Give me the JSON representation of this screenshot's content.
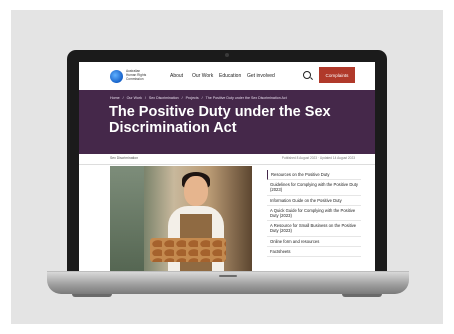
{
  "header": {
    "logo_text": "Australian Human Rights Commission",
    "nav": [
      "About",
      "Our Work",
      "Education",
      "Get involved"
    ],
    "complaints_label": "Complaints"
  },
  "breadcrumb": [
    "Home",
    "/",
    "Our Work",
    "/",
    "Sex Discrimination",
    "/",
    "Projects",
    "/",
    "The Positive Duty under the Sex Discrimination Act"
  ],
  "page_title": "The Positive Duty under the Sex Discrimination Act",
  "meta": {
    "left": "Sex Discrimination",
    "right": "Published 8 August 2023 · Updated 14 August 2023"
  },
  "sidebar": {
    "items": [
      "Resources on the Positive Duty",
      "Guidelines for Complying with the Positive Duty (2023)",
      "Information Guide on the Positive Duty",
      "A Quick Guide for Complying with the Positive Duty (2023)",
      "A Resource for Small Business on the Positive Duty (2023)",
      "Online form and resources",
      "Factsheets"
    ]
  },
  "colors": {
    "hero": "#45284a",
    "complaints_button": "#b0392a"
  }
}
